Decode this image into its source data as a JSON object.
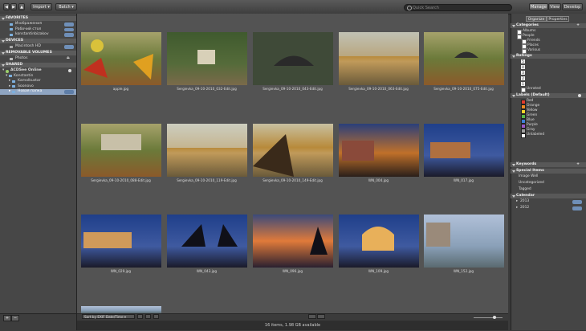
{
  "toolbar": {
    "import_label": "Import",
    "batch_label": "Batch",
    "search_placeholder": "Quick Search",
    "modes": [
      "Manage",
      "View",
      "Develop"
    ]
  },
  "left": {
    "favorites_title": "FAVORITES",
    "favorites": [
      "Изображения",
      "Рабочий стол",
      "konstantinbizakov"
    ],
    "devices_title": "DEVICES",
    "devices": [
      "Macintosh HD"
    ],
    "removable_title": "REMOVABLE VOLUMES",
    "removable": [
      "Photos"
    ],
    "shared_title": "SHARED",
    "shared_root": "ACDSee Online",
    "shared_items": [
      "Konstantin",
      "Kamolkustar",
      "Soonovo",
      "Новая папка"
    ],
    "add_label": "+",
    "remove_label": "−"
  },
  "right": {
    "tabs": [
      "Organize",
      "Properties"
    ],
    "categories_title": "Categories",
    "categories": [
      "Albums",
      "People",
      "Friends",
      "Places",
      "Various"
    ],
    "ratings_title": "Ratings",
    "ratings": [
      "5",
      "4",
      "3",
      "2",
      "1"
    ],
    "unrated": "Unrated",
    "labels_title": "Labels (Default)",
    "labels": [
      {
        "name": "Red",
        "color": "#e23b2e"
      },
      {
        "name": "Orange",
        "color": "#f08a22"
      },
      {
        "name": "Yellow",
        "color": "#f2d42b"
      },
      {
        "name": "Green",
        "color": "#58b847"
      },
      {
        "name": "Blue",
        "color": "#3d7fd6"
      },
      {
        "name": "Purple",
        "color": "#9a5ac9"
      },
      {
        "name": "Gray",
        "color": "#a0a0a0"
      },
      {
        "name": "Unlabeled",
        "color": "#ffffff"
      }
    ],
    "keywords_title": "Keywords",
    "special_title": "Special Items",
    "special": [
      "Image Well",
      "Uncategorized",
      "Tagged"
    ],
    "calendar_title": "Calendar",
    "calendar": [
      "2013",
      "2012"
    ]
  },
  "grid": {
    "items": [
      {
        "caption": "apple.jpg"
      },
      {
        "caption": "Sergievka_09-10-2010_032-Edit.jpg"
      },
      {
        "caption": "Sergievka_09-10-2010_043-Edit.jpg"
      },
      {
        "caption": "Sergievka_09-10-2010_063-Edit.jpg"
      },
      {
        "caption": "Sergievka_09-10-2010_075-Edit.jpg"
      },
      {
        "caption": "Sergievka_09-10-2010_088-Edit.jpg"
      },
      {
        "caption": "Sergievka_09-10-2010_119-Edit.jpg"
      },
      {
        "caption": "Sergievka_09-10-2010_149-Edit.jpg"
      },
      {
        "caption": "WN_004.jpg"
      },
      {
        "caption": "WN_017.jpg"
      },
      {
        "caption": "WN_029.jpg"
      },
      {
        "caption": "WN_043.jpg"
      },
      {
        "caption": "WN_096.jpg"
      },
      {
        "caption": "WN_109.jpg"
      },
      {
        "caption": "WN_152.jpg"
      }
    ]
  },
  "bottom": {
    "sort_label": "Sort by EXIF Date/Time",
    "status": "16 items, 1.98 GB available"
  }
}
